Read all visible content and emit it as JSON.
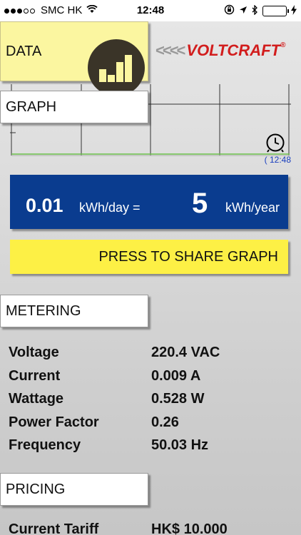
{
  "status_bar": {
    "carrier": "SMC HK",
    "time": "12:48",
    "battery_color": "#4cd964"
  },
  "tabs": {
    "data": "DATA",
    "graph": "GRAPH",
    "metering": "METERING",
    "pricing": "PRICING"
  },
  "brand": {
    "chevrons": "<<<<",
    "name": "VOLTCRAFT",
    "trademark": "®",
    "color": "#d21d1d"
  },
  "graph": {
    "time_label": "( 12:48"
  },
  "energy": {
    "daily_value": "0.01",
    "daily_unit": "kWh/day =",
    "yearly_value": "5",
    "yearly_unit": "kWh/year",
    "panel_color": "#0a3c8f"
  },
  "share": {
    "label": "PRESS TO SHARE GRAPH",
    "color": "#fdf045"
  },
  "metering": [
    {
      "label": "Voltage",
      "value": "220.4 VAC"
    },
    {
      "label": "Current",
      "value": " 0.009 A"
    },
    {
      "label": "Wattage",
      "value": " 0.528 W"
    },
    {
      "label": "Power Factor",
      "value": "0.26"
    },
    {
      "label": "Frequency",
      "value": " 50.03 Hz"
    }
  ],
  "pricing": {
    "tariff_label": "Current Tariff",
    "tariff_value": "HK$ 10.000"
  },
  "icons": [
    "wifi-icon",
    "rotation-lock-icon",
    "location-arrow-icon",
    "bluetooth-icon",
    "battery-icon",
    "charging-bolt-icon",
    "bar-chart-icon",
    "clock-icon"
  ]
}
